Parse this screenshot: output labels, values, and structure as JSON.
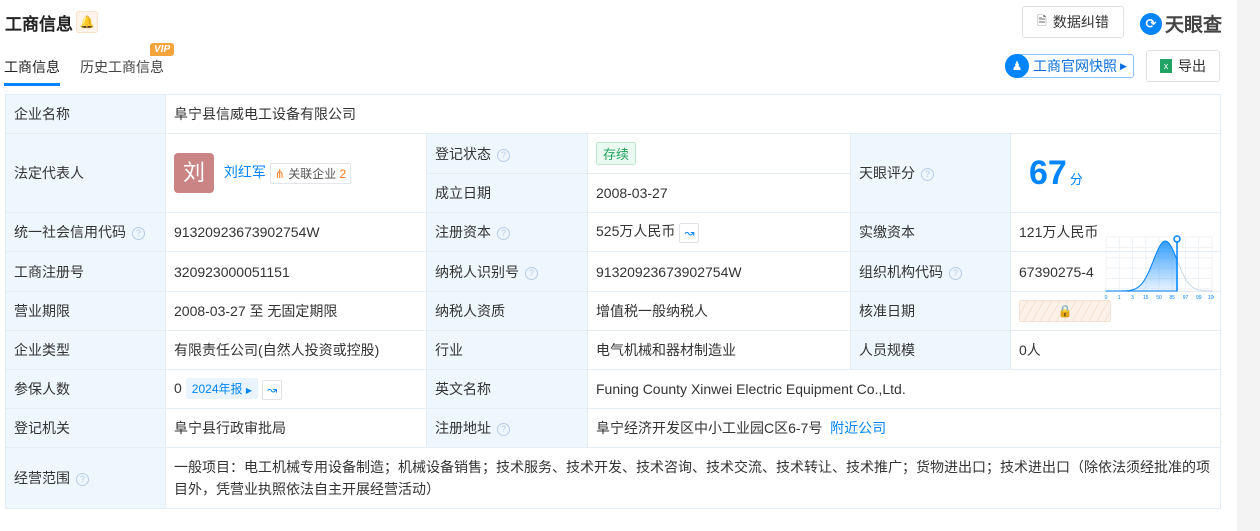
{
  "header": {
    "title": "工商信息",
    "correction": "数据纠错",
    "brand": "天眼查",
    "snapshot": "工商官网快照",
    "export": "导出"
  },
  "tabs": [
    {
      "label": "工商信息",
      "active": true
    },
    {
      "label": "历史工商信息",
      "badge": "VIP"
    }
  ],
  "info": {
    "company_name_label": "企业名称",
    "company_name": "阜宁县信威电工设备有限公司",
    "legal_rep_label": "法定代表人",
    "legal_rep_avatar": "刘",
    "legal_rep": "刘红军",
    "related_label": "关联企业",
    "related_count": "2",
    "status_label": "登记状态",
    "status": "存续",
    "founded_label": "成立日期",
    "founded": "2008-03-27",
    "score_label": "天眼评分",
    "score": "67",
    "score_unit": "分",
    "credit_code_label": "统一社会信用代码",
    "credit_code": "91320923673902754W",
    "reg_capital_label": "注册资本",
    "reg_capital": "525万人民币",
    "paid_capital_label": "实缴资本",
    "paid_capital": "121万人民币",
    "reg_no_label": "工商注册号",
    "reg_no": "320923000051151",
    "taxpayer_id_label": "纳税人识别号",
    "taxpayer_id": "91320923673902754W",
    "org_code_label": "组织机构代码",
    "org_code": "67390275-4",
    "term_label": "营业期限",
    "term": "2008-03-27 至 无固定期限",
    "taxpayer_qual_label": "纳税人资质",
    "taxpayer_qual": "增值税一般纳税人",
    "approve_date_label": "核准日期",
    "type_label": "企业类型",
    "type": "有限责任公司(自然人投资或控股)",
    "industry_label": "行业",
    "industry": "电气机械和器材制造业",
    "staff_label": "人员规模",
    "staff": "0人",
    "insured_label": "参保人数",
    "insured": "0",
    "report": "2024年报",
    "en_name_label": "英文名称",
    "en_name": "Funing County Xinwei Electric Equipment Co.,Ltd.",
    "authority_label": "登记机关",
    "authority": "阜宁县行政审批局",
    "address_label": "注册地址",
    "address": "阜宁经济开发区中小工业园C区6-7号",
    "nearby": "附近公司",
    "scope_label": "经营范围",
    "scope": "一般项目：电工机械专用设备制造；机械设备销售；技术服务、技术开发、技术咨询、技术交流、技术转让、技术推广；货物进出口；技术进出口（除依法须经批准的项目外，凭营业执照依法自主开展经营活动）"
  },
  "score_chart": {
    "ticks": [
      "0",
      "1",
      "3",
      "15",
      "50",
      "85",
      "97",
      "99",
      "100"
    ],
    "accent": "#0084ff"
  }
}
